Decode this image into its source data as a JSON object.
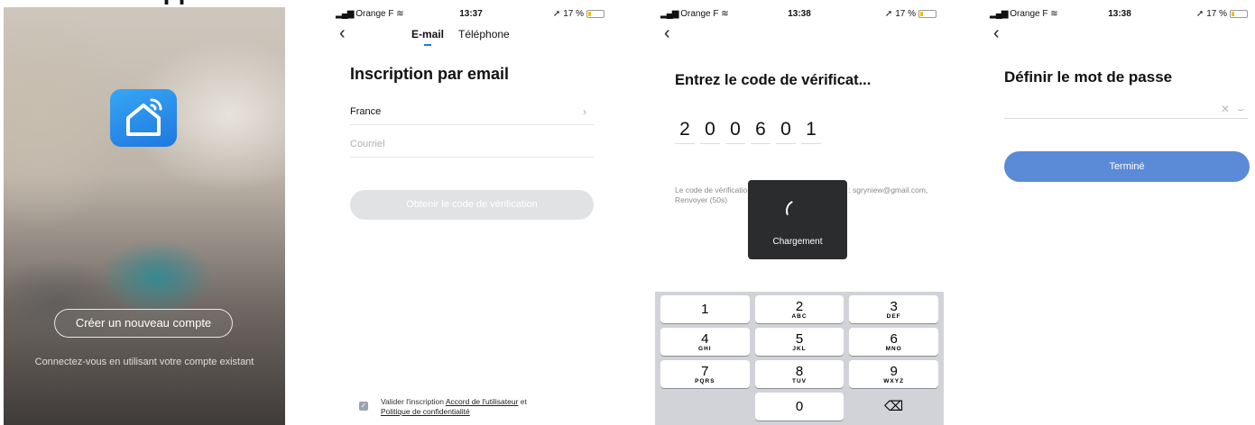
{
  "page": {
    "partial_title": "applic"
  },
  "screen1": {
    "create_account_button": "Créer un nouveau compte",
    "login_existing_link": "Connectez-vous en utilisant votre compte existant",
    "icon": "smart-home-icon"
  },
  "statusbar": {
    "s2": {
      "carrier": "Orange F",
      "time": "13:37",
      "battery": "17 %"
    },
    "s3": {
      "carrier": "Orange F",
      "time": "13:38",
      "battery": "17 %"
    },
    "s4": {
      "carrier": "Orange F",
      "time": "13:38",
      "battery": "17 %"
    }
  },
  "screen2": {
    "tabs": [
      {
        "label": "E-mail",
        "active": true
      },
      {
        "label": "Téléphone",
        "active": false
      }
    ],
    "title": "Inscription par email",
    "country": "France",
    "email_placeholder": "Courriel",
    "get_code_button": "Obtenir le code de vérification",
    "agree_prefix": "Valider l'inscription ",
    "user_agreement_link": "Accord de l'utilisateur",
    "agree_and": " et",
    "privacy_link": "Politique de confidentialité"
  },
  "screen3": {
    "title": "Entrez le code de vérificat...",
    "code_digits": [
      "2",
      "0",
      "0",
      "6",
      "0",
      "1"
    ],
    "sent_message": "Le code de vérification a été envoyé à votre e-mail : sgryniew@gmail.com, Renvoyer (50s)",
    "loading_label": "Chargement",
    "keypad": [
      {
        "num": "1",
        "letters": ""
      },
      {
        "num": "2",
        "letters": "ABC"
      },
      {
        "num": "3",
        "letters": "DEF"
      },
      {
        "num": "4",
        "letters": "GHI"
      },
      {
        "num": "5",
        "letters": "JKL"
      },
      {
        "num": "6",
        "letters": "MNO"
      },
      {
        "num": "7",
        "letters": "PQRS"
      },
      {
        "num": "8",
        "letters": "TUV"
      },
      {
        "num": "9",
        "letters": "WXYZ"
      },
      {
        "num": "",
        "letters": ""
      },
      {
        "num": "0",
        "letters": ""
      },
      {
        "num": "⌫",
        "letters": ""
      }
    ]
  },
  "screen4": {
    "title": "Définir le mot de passe",
    "done_button": "Terminé"
  },
  "colors": {
    "primary_button": "#5b8ad6",
    "disabled_button": "#e1e2e4",
    "app_icon": "#1f78e0",
    "tab_indicator": "#1f78e0"
  }
}
